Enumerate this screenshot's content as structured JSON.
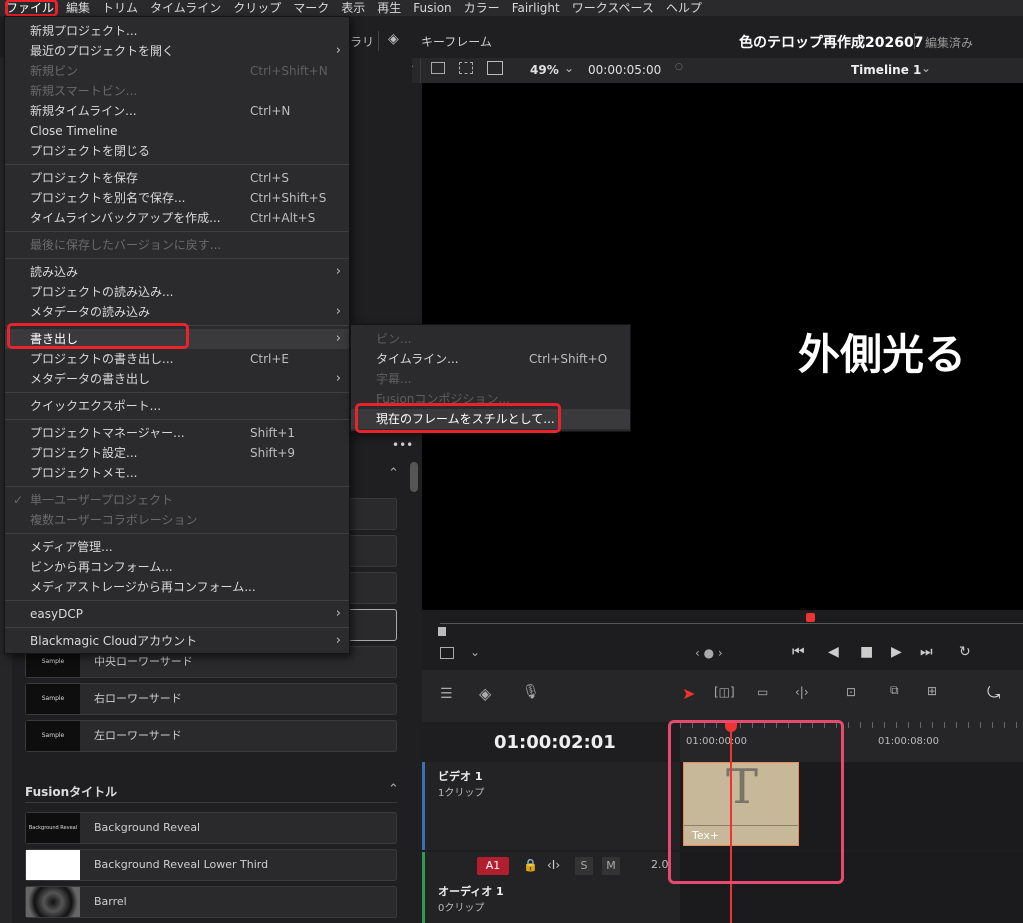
{
  "menubar": {
    "items": [
      "ファイル",
      "編集",
      "トリム",
      "タイムライン",
      "クリップ",
      "マーク",
      "表示",
      "再生",
      "Fusion",
      "カラー",
      "Fairlight",
      "ワークスペース",
      "ヘルプ"
    ]
  },
  "header": {
    "project_title": "色のテロップ再作成202607",
    "status": "編集済み",
    "keyframe_label": "キーフレーム",
    "partial_label": "ラリ"
  },
  "viewer": {
    "zoom": "49%",
    "timecode": "00:00:05:00",
    "timeline_name": "Timeline 1",
    "overlay_text": "外側光る"
  },
  "file_menu": {
    "items": [
      {
        "label": "新規プロジェクト...",
        "shortcut": "",
        "disabled": false
      },
      {
        "label": "最近のプロジェクトを開く",
        "shortcut": "",
        "disabled": false,
        "submenu": true
      },
      {
        "label": "新規ビン",
        "shortcut": "Ctrl+Shift+N",
        "disabled": true
      },
      {
        "label": "新規スマートビン...",
        "shortcut": "",
        "disabled": true
      },
      {
        "label": "新規タイムライン...",
        "shortcut": "Ctrl+N",
        "disabled": false
      },
      {
        "label": "Close Timeline",
        "shortcut": "",
        "disabled": false
      },
      {
        "label": "プロジェクトを閉じる",
        "shortcut": "",
        "disabled": false
      },
      {
        "label": "プロジェクトを保存",
        "shortcut": "Ctrl+S",
        "disabled": false
      },
      {
        "label": "プロジェクトを別名で保存...",
        "shortcut": "Ctrl+Shift+S",
        "disabled": false
      },
      {
        "label": "タイムラインバックアップを作成...",
        "shortcut": "Ctrl+Alt+S",
        "disabled": false
      },
      {
        "label": "最後に保存したバージョンに戻す...",
        "shortcut": "",
        "disabled": true
      },
      {
        "label": "読み込み",
        "shortcut": "",
        "disabled": false,
        "submenu": true
      },
      {
        "label": "プロジェクトの読み込み...",
        "shortcut": "",
        "disabled": false
      },
      {
        "label": "メタデータの読み込み",
        "shortcut": "",
        "disabled": false,
        "submenu": true
      },
      {
        "label": "書き出し",
        "shortcut": "",
        "disabled": false,
        "submenu": true
      },
      {
        "label": "プロジェクトの書き出し...",
        "shortcut": "Ctrl+E",
        "disabled": false
      },
      {
        "label": "メタデータの書き出し",
        "shortcut": "",
        "disabled": false,
        "submenu": true
      },
      {
        "label": "クイックエクスポート...",
        "shortcut": "",
        "disabled": false
      },
      {
        "label": "プロジェクトマネージャー...",
        "shortcut": "Shift+1",
        "disabled": false
      },
      {
        "label": "プロジェクト設定...",
        "shortcut": "Shift+9",
        "disabled": false
      },
      {
        "label": "プロジェクトメモ...",
        "shortcut": "",
        "disabled": false
      },
      {
        "label": "単一ユーザープロジェクト",
        "shortcut": "",
        "disabled": true
      },
      {
        "label": "複数ユーザーコラボレーション",
        "shortcut": "",
        "disabled": true
      },
      {
        "label": "メディア管理...",
        "shortcut": "",
        "disabled": false
      },
      {
        "label": "ビンから再コンフォーム...",
        "shortcut": "",
        "disabled": false
      },
      {
        "label": "メディアストレージから再コンフォーム...",
        "shortcut": "",
        "disabled": false
      },
      {
        "label": "easyDCP",
        "shortcut": "",
        "disabled": false,
        "submenu": true
      },
      {
        "label": "Blackmagic Cloudアカウント",
        "shortcut": "",
        "disabled": false,
        "submenu": true
      }
    ]
  },
  "export_submenu": {
    "items": [
      {
        "label": "ビン...",
        "shortcut": "",
        "disabled": true
      },
      {
        "label": "タイムライン...",
        "shortcut": "Ctrl+Shift+O",
        "disabled": false
      },
      {
        "label": "字幕...",
        "shortcut": "",
        "disabled": true
      },
      {
        "label": "Fusionコンポジション...",
        "shortcut": "",
        "disabled": true
      },
      {
        "label": "現在のフレームをスチルとして...",
        "shortcut": "",
        "disabled": false
      }
    ]
  },
  "titles": {
    "cards": [
      "中央ローワーサード",
      "右ローワーサード",
      "左ローワーサード"
    ],
    "thumb_text": "Sample",
    "fusion_section": "Fusionタイトル",
    "fusion_cards": [
      "Background Reveal",
      "Background Reveal Lower Third",
      "Barrel"
    ],
    "thumb_fusion": "Background Reveal"
  },
  "timeline": {
    "timecode": "01:00:02:01",
    "ruler": [
      "01:00:00:00",
      "01:00:08:00"
    ],
    "video_track": "ビデオ 1",
    "video_clips": "1クリップ",
    "audio_track": "オーディオ 1",
    "audio_clips": "0クリップ",
    "audio_id": "A1",
    "audio_level": "2.0",
    "solo": "S",
    "mute": "M",
    "clip_label": "Tex+",
    "clip_glyph": "T"
  },
  "colors": {
    "accent_red": "#e8232b",
    "highlight_pink": "#e64a6f",
    "clip": "#c8b89a",
    "playhead": "#e33"
  }
}
